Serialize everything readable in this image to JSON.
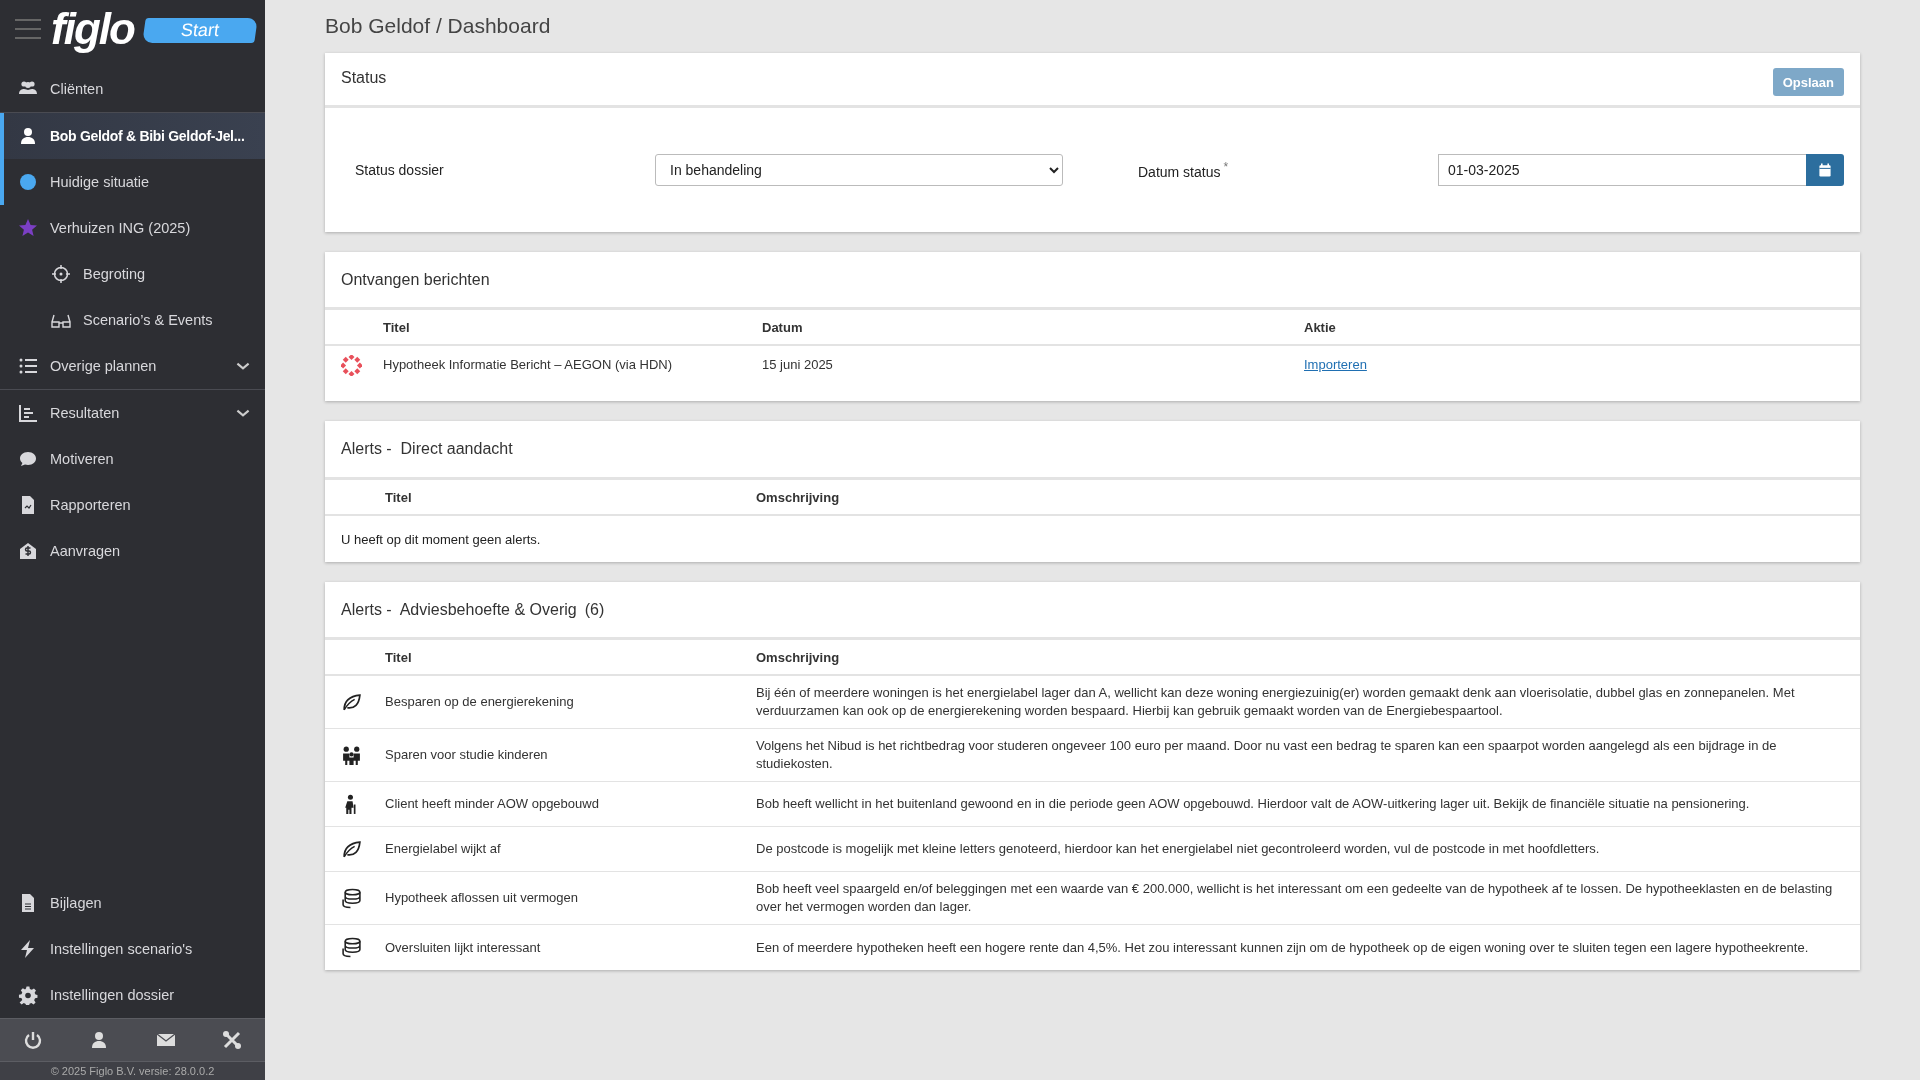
{
  "sidebar": {
    "logo": "figlo",
    "start_button": "Start",
    "items": [
      {
        "kind": "item",
        "label": "Cliënten",
        "selected": false,
        "current": false
      },
      {
        "kind": "item",
        "label": "Bob Geldof & Bibi Geldof-Jel...",
        "selected": true,
        "current": true
      },
      {
        "kind": "item",
        "color": "#4aa8f0",
        "label": "Huidige situatie",
        "selected": false,
        "current": true
      },
      {
        "kind": "item",
        "color": "#7b3fc4",
        "label": "Verhuizen ING (2025)",
        "selected": false,
        "current": false
      },
      {
        "kind": "sub",
        "label": "Begroting",
        "selected": false,
        "current": false
      },
      {
        "kind": "sub",
        "label": "Scenario’s & Events",
        "selected": false,
        "current": false
      },
      {
        "kind": "group",
        "label": "Overige plannen",
        "selected": false,
        "current": false,
        "expanded": false
      },
      {
        "kind": "group",
        "label": "Resultaten",
        "selected": false,
        "current": false,
        "expanded": false
      },
      {
        "kind": "item",
        "label": "Motiveren",
        "selected": false,
        "current": false
      },
      {
        "kind": "item",
        "label": "Rapporteren",
        "selected": false,
        "current": false
      },
      {
        "kind": "item",
        "label": "Aanvragen",
        "selected": false,
        "current": false
      }
    ],
    "bottom_items": [
      {
        "label": "Bijlagen"
      },
      {
        "label": "Instellingen scenario's"
      },
      {
        "label": "Instellingen dossier"
      }
    ],
    "copyright": "© 2025 Figlo B.V. versie: 28.0.0.2"
  },
  "page_title": "Bob Geldof / Dashboard",
  "status_card": {
    "title": "Status",
    "save_button": {
      "label": "Opslaan",
      "disabled": true
    },
    "status_label": "Status dossier",
    "status_value": "In behandeling",
    "date_label": "Datum status",
    "required_mark": "*",
    "date_value": "01-03-2025"
  },
  "messages": {
    "title": "Ontvangen berichten",
    "columns": [
      "Titel",
      "Datum",
      "Aktie"
    ],
    "rows": [
      {
        "title": "Hypotheek Informatie Bericht – AEGON (via HDN)",
        "date": "15 juni 2025",
        "action": "Importeren"
      }
    ]
  },
  "alerts_direct": {
    "title": "Alerts -  Direct aandacht",
    "columns": [
      "Titel",
      "Omschrijving"
    ],
    "empty_text": "U heeft op dit moment geen alerts."
  },
  "alerts_advice": {
    "title": "Alerts -  Adviesbehoefte & Overig",
    "count": "(6)",
    "columns": [
      "Titel",
      "Omschrijving"
    ],
    "rows": [
      {
        "title": "Besparen op de energierekening",
        "description": "Bij één of meerdere woningen is het energielabel lager dan A, wellicht kan deze woning energiezuinig(er) worden gemaakt denk aan vloerisolatie, dubbel glas en zonnepanelen. Met verduurzamen kan ook op de energierekening worden bespaard. Hierbij kan gebruik gemaakt worden van de Energiebespaartool."
      },
      {
        "title": "Sparen voor studie kinderen",
        "description": "Volgens het Nibud is het richtbedrag voor studeren ongeveer 100 euro per maand. Door nu vast een bedrag te sparen kan een spaarpot worden aangelegd als een bijdrage in de studiekosten."
      },
      {
        "title": "Client heeft minder AOW opgebouwd",
        "description": "Bob heeft wellicht in het buitenland gewoond en in die periode geen AOW opgebouwd. Hierdoor valt de AOW-uitkering lager uit. Bekijk de financiële situatie na pensionering."
      },
      {
        "title": "Energielabel wijkt af",
        "description": "De postcode is mogelijk met kleine letters genoteerd, hierdoor kan het energielabel niet gecontroleerd worden, vul de postcode in met hoofdletters."
      },
      {
        "title": "Hypotheek aflossen uit vermogen",
        "description": "Bob heeft veel spaargeld en/of beleggingen met een waarde van € 200.000, wellicht is het interessant om een gedeelte van de hypotheek af te lossen. De hypotheeklasten en de belasting over het vermogen worden dan lager."
      },
      {
        "title": "Oversluiten lijkt interessant",
        "description": "Een of meerdere hypotheken heeft een hogere rente dan 4,5%. Het zou interessant kunnen zijn om de hypotheek op de eigen woning over te sluiten tegen een lagere hypotheekrente."
      }
    ]
  }
}
